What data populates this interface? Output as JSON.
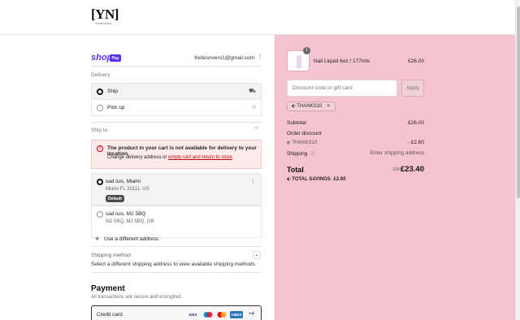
{
  "header": {
    "logo_main": "[YN]",
    "logo_sub": "YOUR NAILS"
  },
  "account": {
    "shop_logo": "shop",
    "pay_badge": "Pay",
    "email": "freitesrivero1@gmail.com",
    "menu_glyph": "⋮"
  },
  "delivery": {
    "label": "Delivery",
    "options": [
      {
        "label": "Ship",
        "selected": true,
        "icon": "truck-icon",
        "glyph": "⛟"
      },
      {
        "label": "Pick up",
        "selected": false,
        "icon": "store-icon",
        "glyph": "⌂"
      }
    ]
  },
  "ship_to": {
    "label": "Ship to",
    "chevron": "⌃",
    "alert_title": "The product in your cart is not available for delivery to your location.",
    "alert_body_prefix": "Change delivery address or ",
    "alert_link": "empty cart and return to store",
    "alert_body_suffix": ".",
    "addresses": [
      {
        "name": "sad luis, Miami",
        "line": "Miami FL 33111, US",
        "badge": "Default",
        "selected": true
      },
      {
        "name": "sad luis, M2 5BQ",
        "line": "M2 5BQ, M2 5BQ, GB",
        "selected": false
      }
    ],
    "new_address_label": "Use a different address"
  },
  "shipping_method": {
    "label": "Shipping method",
    "chevron": "⌄",
    "message": "Select a different shipping address to view available shipping methods"
  },
  "payment": {
    "heading": "Payment",
    "subheading": "All transactions are secure and encrypted.",
    "method_label": "Credit card",
    "cards": [
      {
        "name": "VISA",
        "color": "#1a1f71"
      },
      {
        "name": "maestro",
        "color": "#0099df"
      },
      {
        "name": "mastercard",
        "color": "#eb001b"
      },
      {
        "name": "AMEX",
        "color": "#2e77bc"
      }
    ],
    "more_cards": "+4"
  },
  "cart": {
    "quantity": "1",
    "product_name": "Nail Liquid 6oz / 177mls",
    "product_price": "£26.00",
    "discount_placeholder": "Discount code or gift card",
    "apply_label": "Apply",
    "applied_code": "THANKS10",
    "remove_glyph": "✕",
    "subtotal_label": "Subtotal",
    "subtotal_value": "£26.00",
    "order_discount_label": "Order discount",
    "discount_code": "THANKS10",
    "discount_value": "- £2.60",
    "shipping_label": "Shipping",
    "shipping_value": "Enter shipping address",
    "total_label": "Total",
    "total_currency": "GBP",
    "total_value": "£23.40",
    "savings_label": "TOTAL SAVINGS",
    "savings_value": "£2.60"
  },
  "colors": {
    "accent_pink": "#f6c3d0",
    "shop_purple": "#5a31f4",
    "error_red": "#cc0000"
  }
}
